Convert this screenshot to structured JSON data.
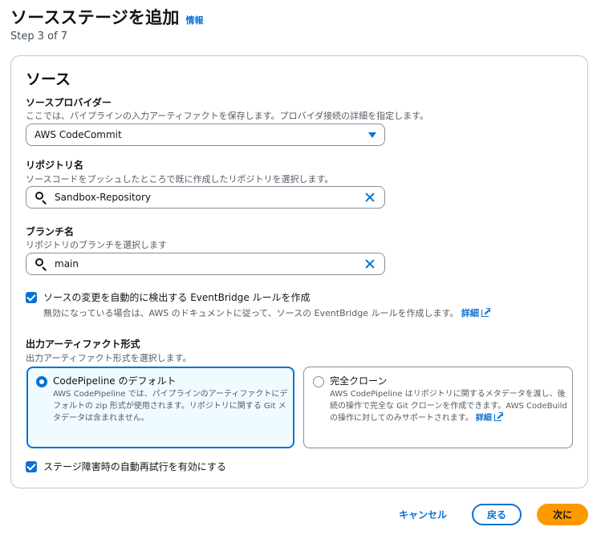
{
  "header": {
    "title": "ソースステージを追加",
    "info_link": "情報",
    "step": "Step 3 of 7"
  },
  "source": {
    "title": "ソース",
    "provider": {
      "label": "ソースプロバイダー",
      "description": "ここでは、パイプラインの入力アーティファクトを保存します。プロバイダ接続の詳細を指定します。",
      "value": "AWS CodeCommit"
    },
    "repository": {
      "label": "リポジトリ名",
      "description": "ソースコードをプッシュしたところで既に作成したリポジトリを選択します。",
      "value": "Sandbox-Repository"
    },
    "branch": {
      "label": "ブランチ名",
      "description": "リポジトリのブランチを選択します",
      "value": "main"
    },
    "change_detection": {
      "checked": true,
      "label": "ソースの変更を自動的に検出する EventBridge ルールを作成",
      "description": "無効になっている場合は、AWS のドキュメントに従って、ソースの EventBridge ルールを作成します。",
      "link": "詳細"
    },
    "artifact_format": {
      "label": "出力アーティファクト形式",
      "description": "出力アーティファクト形式を選択します。",
      "options": [
        {
          "title": "CodePipeline のデフォルト",
          "description": "AWS CodePipeline では、パイプラインのアーティファクトにデフォルトの zip 形式が使用されます。リポジトリに関する Git メタデータは含まれません。",
          "selected": true
        },
        {
          "title": "完全クローン",
          "description": "AWS CodePipeline はリポジトリに関するメタデータを渡し、後続の操作で完全な Git クローンを作成できます。AWS CodeBuild の操作に対してのみサポートされます。",
          "link": "詳細",
          "selected": false
        }
      ]
    },
    "retry": {
      "checked": true,
      "label": "ステージ障害時の自動再試行を有効にする"
    }
  },
  "footer": {
    "cancel": "キャンセル",
    "back": "戻る",
    "next": "次に"
  },
  "colors": {
    "accent": "#0972d3",
    "primary_button": "#ff9900"
  }
}
